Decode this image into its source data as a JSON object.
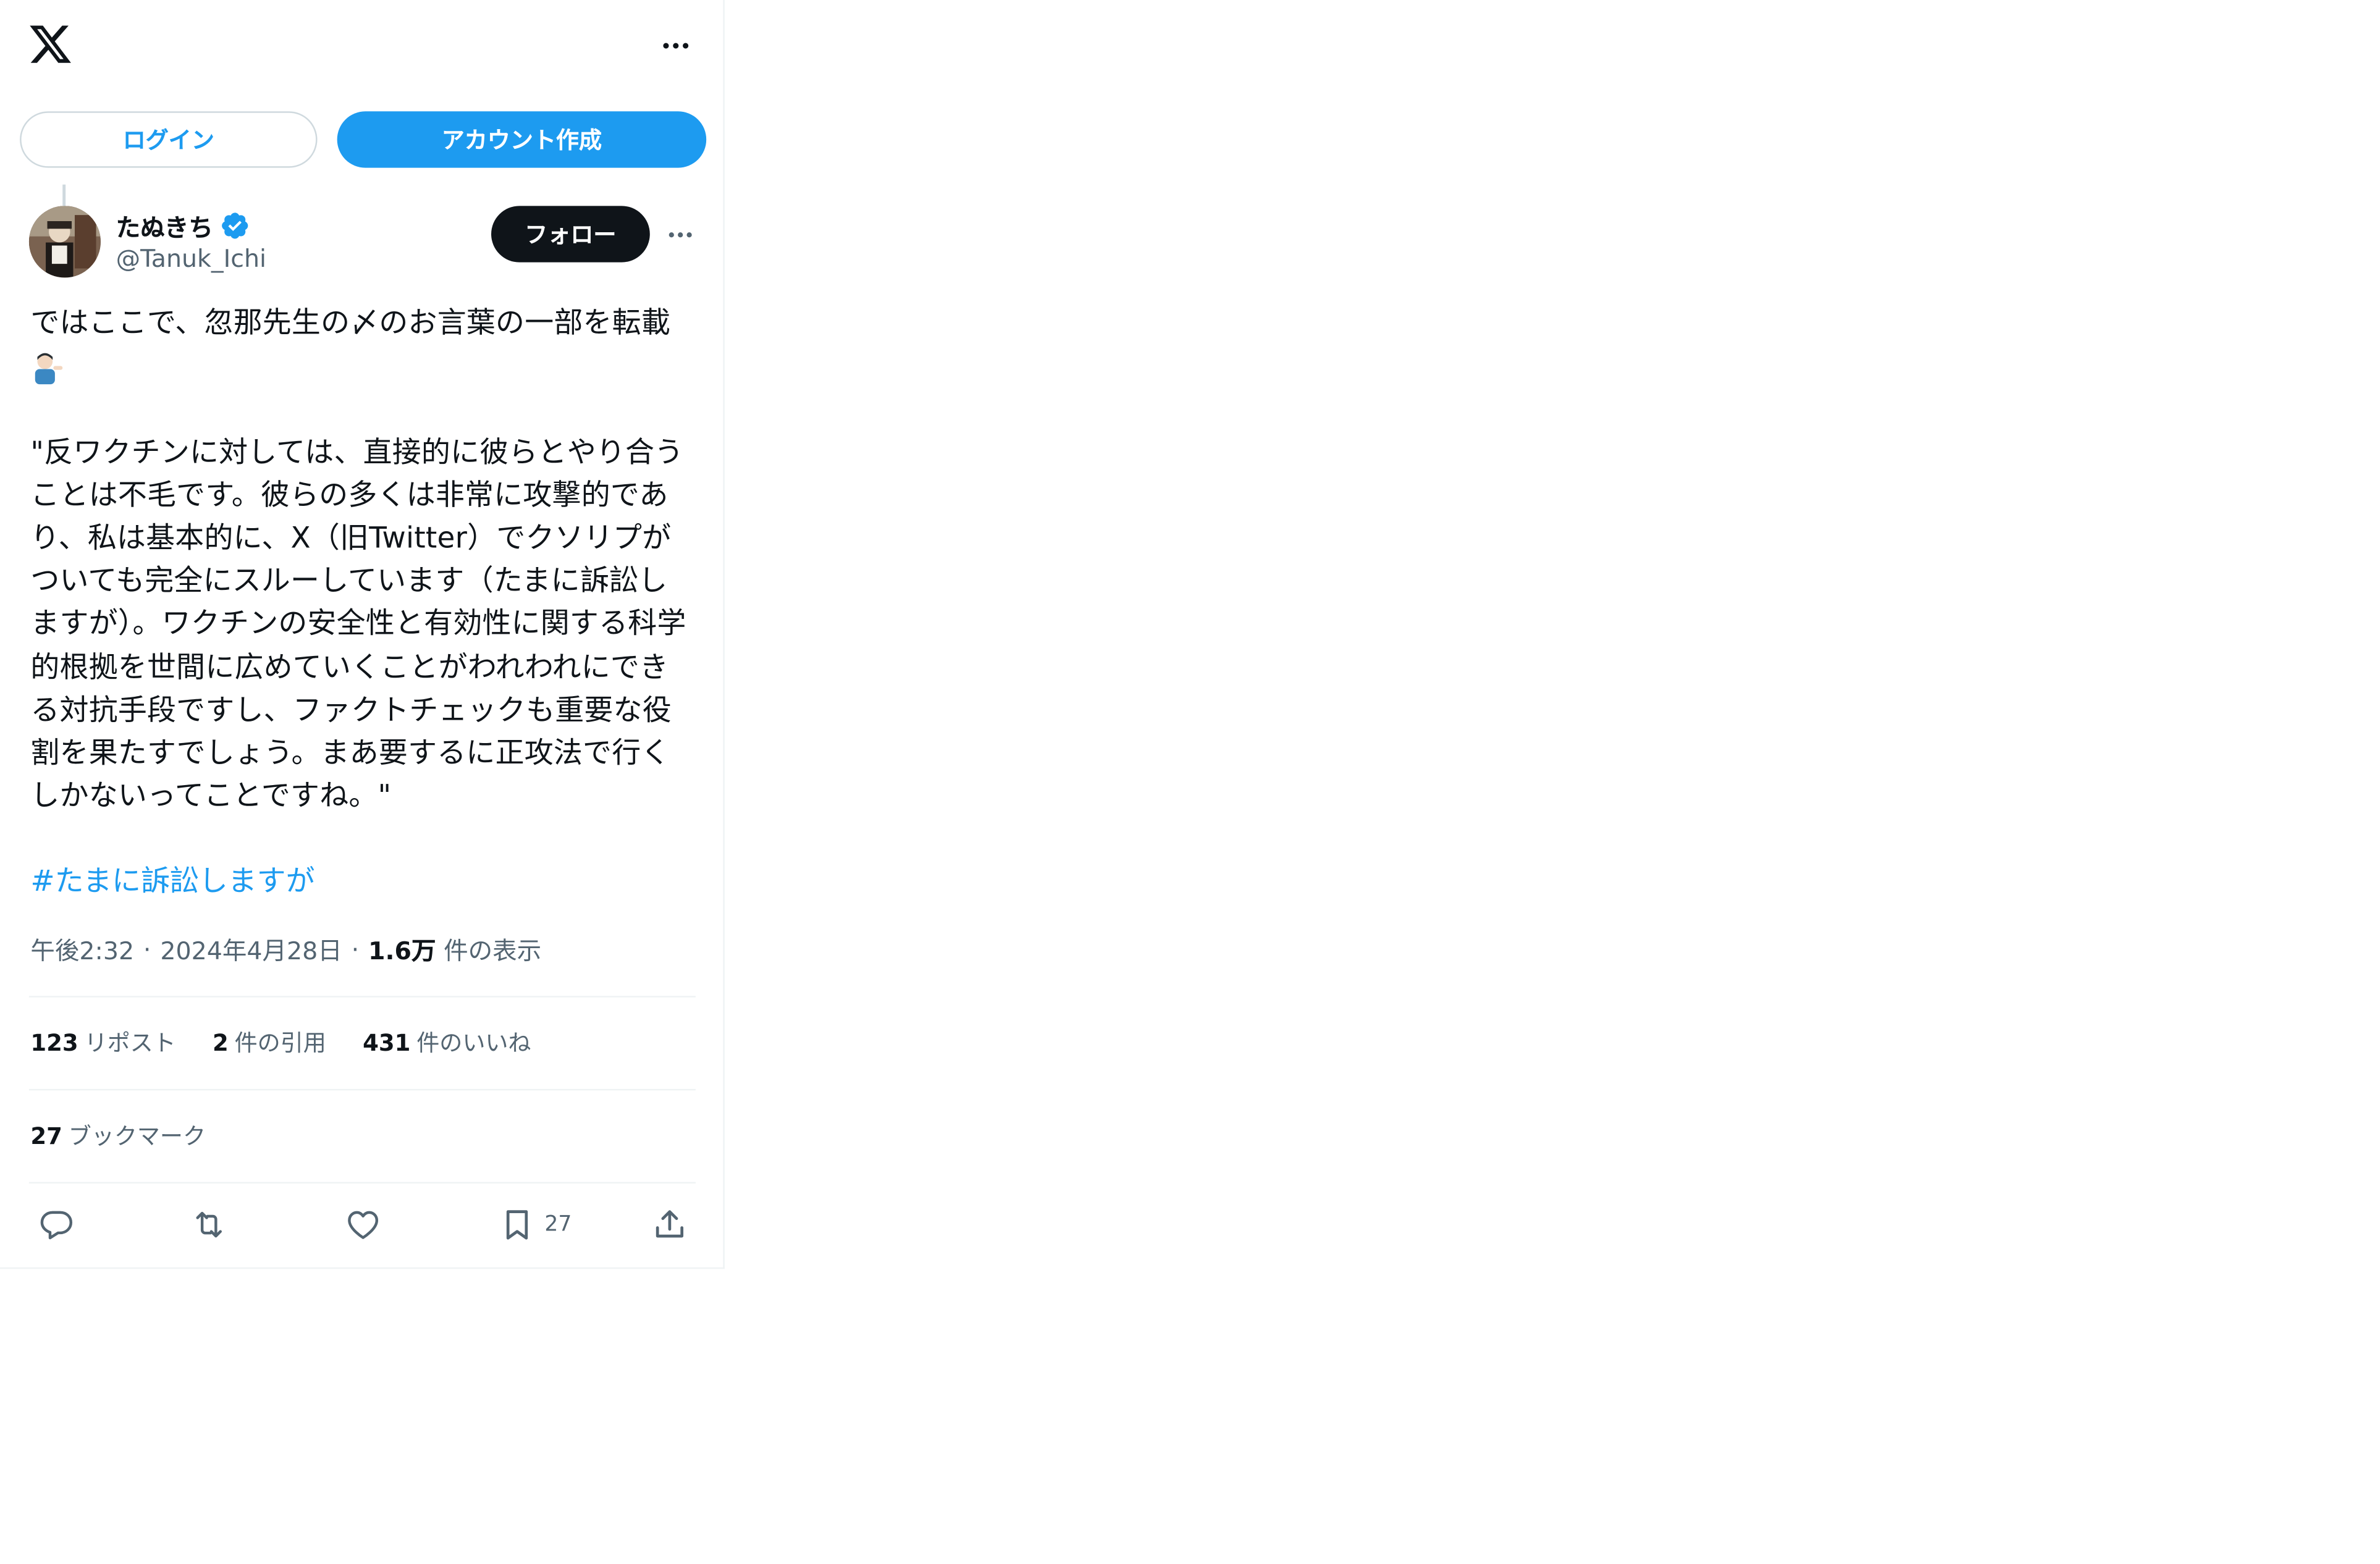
{
  "header": {
    "logo_icon": "x-logo-icon",
    "more_icon": "more-horizontal-icon"
  },
  "auth": {
    "login_label": "ログイン",
    "signup_label": "アカウント作成",
    "accent_color": "#1d9bf0"
  },
  "post": {
    "author": {
      "display_name": "たぬきち",
      "handle": "@Tanuk_Ichi",
      "verified": true
    },
    "follow_label": "フォロー",
    "text": "ではここで、忽那先生の〆のお言葉の一部を転載",
    "quote": "\"反ワクチンに対しては、直接的に彼らとやり合うことは不毛です。彼らの多くは非常に攻撃的であり、私は基本的に、X（旧Twitter）でクソリプがついても完全にスルーしています（たまに訴訟しますが）。ワクチンの安全性と有効性に関する科学的根拠を世間に広めていくことがわれわれにできる対抗手段ですし、ファクトチェックも重要な役割を果たすでしょう。まあ要するに正攻法で行くしかないってことですね。\"",
    "hashtag": "#たまに訴訟しますが",
    "time": "午後2:32",
    "date": "2024年4月28日",
    "views_count": "1.6万",
    "views_label": "件の表示",
    "reposts_count": "123",
    "reposts_label": "リポスト",
    "quotes_count": "2",
    "quotes_label": "件の引用",
    "likes_count": "431",
    "likes_label": "件のいいね",
    "bookmarks_count": "27",
    "bookmarks_label": "ブックマーク"
  },
  "actions": {
    "bookmark_count": "27"
  }
}
